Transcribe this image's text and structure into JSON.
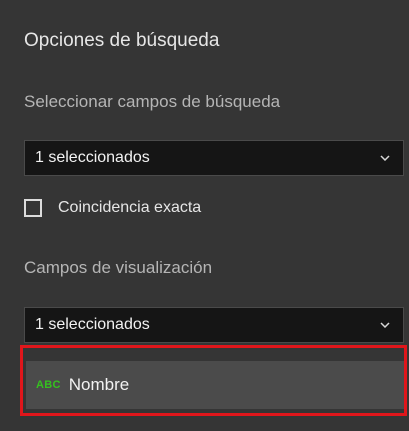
{
  "panel": {
    "title": "Opciones de búsqueda",
    "search_fields": {
      "label": "Seleccionar campos de búsqueda",
      "selected": "1 seleccionados",
      "chevron_icon": "chevron-down-icon"
    },
    "exact_match": {
      "label": "Coincidencia exacta",
      "checked": false
    },
    "display_fields": {
      "label": "Campos de visualización",
      "selected": "1 seleccionados",
      "chevron_icon": "chevron-down-icon",
      "options": [
        {
          "type_badge": "ABC",
          "name": "Nombre"
        }
      ]
    }
  },
  "colors": {
    "panel_bg": "#353535",
    "select_bg": "#151515",
    "option_bg": "#4b4b4b",
    "highlight_border": "#e0161b",
    "field_type_green": "#35c01f"
  }
}
